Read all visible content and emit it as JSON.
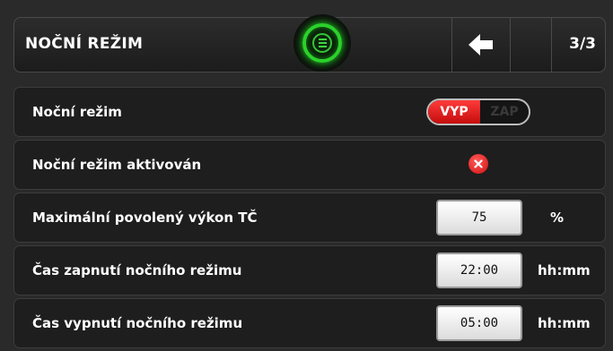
{
  "header": {
    "title": "NOČNÍ REŽIM",
    "page_indicator": "3/3",
    "menu_icon": "menu-icon",
    "back_icon": "arrow-left-icon",
    "accent_color": "#2bd12b"
  },
  "rows": [
    {
      "label": "Noční režim",
      "toggle": {
        "on_label": "VYP",
        "off_label": "ZAP",
        "selected": "VYP",
        "active_color": "#e01818"
      }
    },
    {
      "label": "Noční režim aktivován",
      "status_icon": "error-x-icon",
      "status_color": "#d01010"
    },
    {
      "label": "Maximální povolený výkon TČ",
      "value": "75",
      "unit": "%"
    },
    {
      "label": "Čas zapnutí nočního režimu",
      "value": "22:00",
      "unit": "hh:mm"
    },
    {
      "label": "Čas vypnutí nočního režimu",
      "value": "05:00",
      "unit": "hh:mm"
    }
  ]
}
